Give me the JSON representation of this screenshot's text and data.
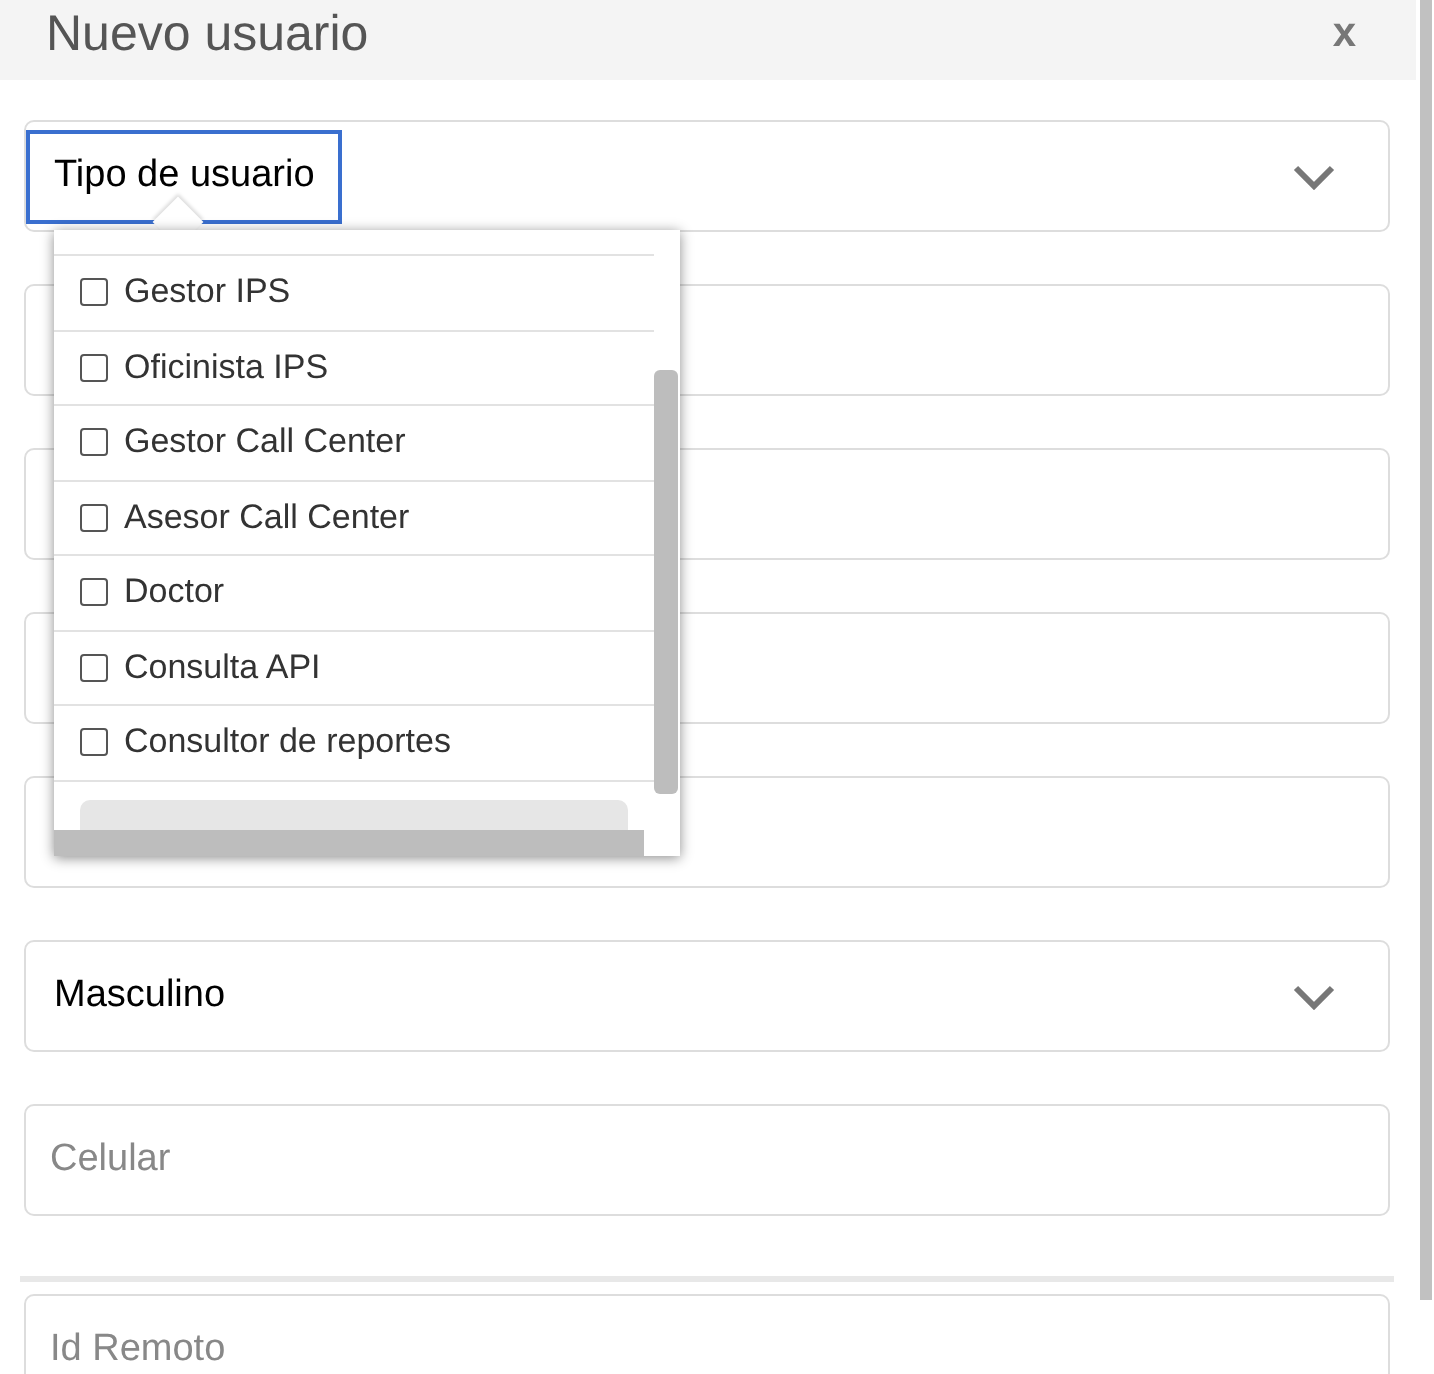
{
  "dialog": {
    "title": "Nuevo usuario",
    "close": "x"
  },
  "fields": [
    {
      "kind": "select",
      "value": "Tipo de usuario",
      "focused": true
    },
    {
      "kind": "covered"
    },
    {
      "kind": "covered"
    },
    {
      "kind": "covered"
    },
    {
      "kind": "covered"
    },
    {
      "kind": "select",
      "value": "Masculino",
      "focused": false
    },
    {
      "kind": "text",
      "placeholder": "Celular"
    },
    {
      "kind": "divider"
    },
    {
      "kind": "text",
      "placeholder": "Id Remoto"
    }
  ],
  "dropdown": {
    "options": [
      {
        "label": "Gestor IPS",
        "checked": false
      },
      {
        "label": "Oficinista IPS",
        "checked": false
      },
      {
        "label": "Gestor Call Center",
        "checked": false
      },
      {
        "label": "Asesor Call Center",
        "checked": false
      },
      {
        "label": "Doctor",
        "checked": false
      },
      {
        "label": "Consulta API",
        "checked": false
      },
      {
        "label": "Consultor de reportes",
        "checked": false
      }
    ]
  }
}
